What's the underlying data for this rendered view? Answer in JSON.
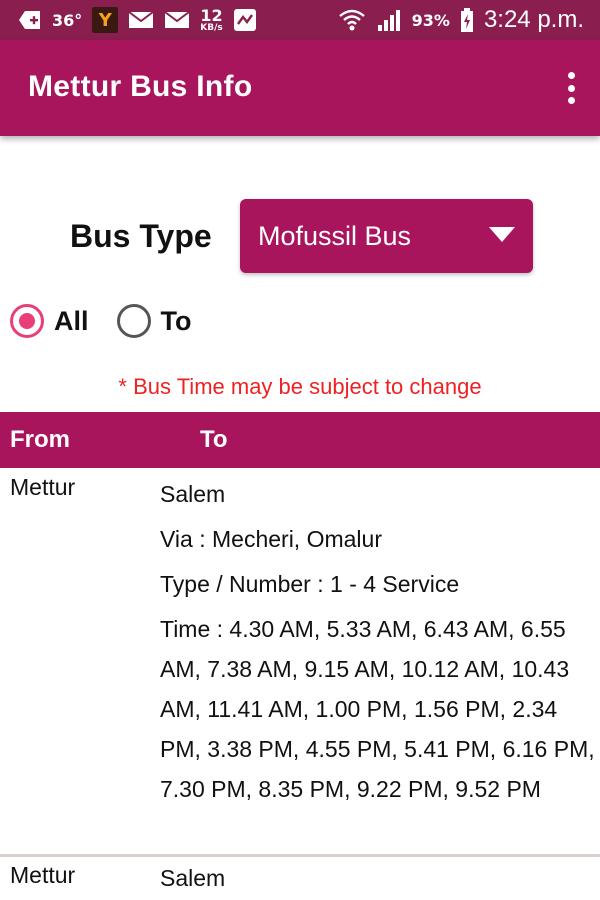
{
  "status_bar": {
    "temperature": "36°",
    "net_speed": "12",
    "net_speed_unit": "KB/s",
    "battery": "93%",
    "time": "3:24 p.m."
  },
  "toolbar": {
    "title": "Mettur Bus Info"
  },
  "bus_type": {
    "label": "Bus Type",
    "selected": "Mofussil Bus"
  },
  "filter": {
    "options": [
      "All",
      "To"
    ],
    "selected": "All"
  },
  "notice": "* Bus Time may be subject to change",
  "table": {
    "headers": {
      "from": "From",
      "to": "To"
    },
    "rows": [
      {
        "from": "Mettur",
        "to": "Salem",
        "via": "Via : Mecheri, Omalur",
        "type": "Type / Number :  1 - 4 Service",
        "time": "Time : 4.30 AM, 5.33 AM, 6.43 AM, 6.55 AM, 7.38 AM, 9.15 AM, 10.12 AM, 10.43 AM, 11.41 AM, 1.00 PM, 1.56 PM, 2.34 PM, 3.38 PM, 4.55 PM, 5.41 PM, 6.16 PM, 7.30 PM, 8.35 PM, 9.22 PM, 9.52 PM"
      },
      {
        "from": "Mettur",
        "to": "Salem"
      }
    ]
  },
  "colors": {
    "primary": "#a8155c",
    "status_bar": "#8a1f4f",
    "accent": "#e83e79",
    "notice": "#ee2222"
  }
}
